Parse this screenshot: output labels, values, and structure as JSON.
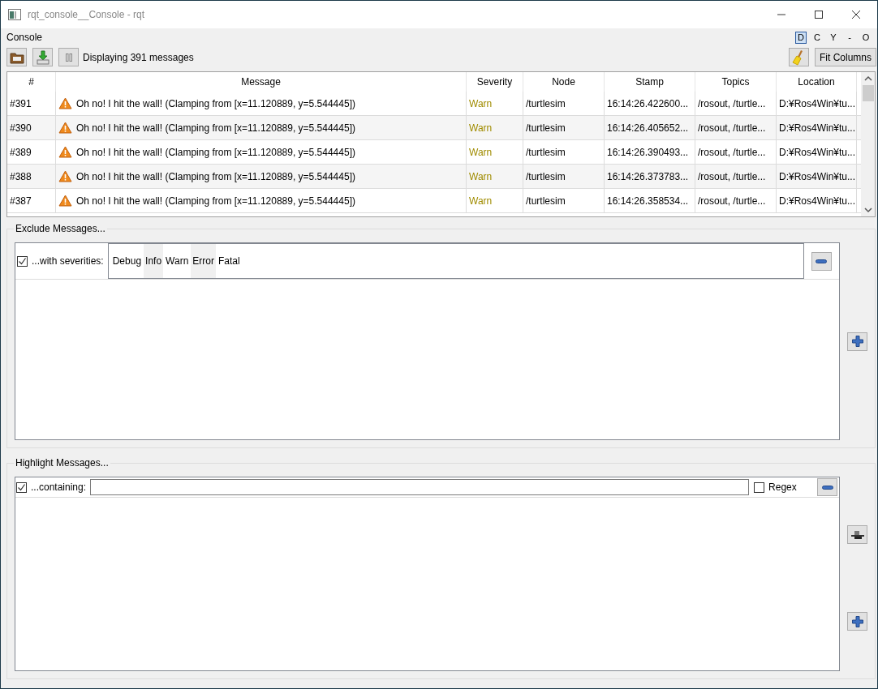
{
  "window": {
    "title": "rqt_console__Console - rqt"
  },
  "dock": {
    "title": "Console",
    "buttons": [
      {
        "label": "D",
        "selected": true
      },
      {
        "label": "C",
        "selected": false
      },
      {
        "label": "Y",
        "selected": false
      },
      {
        "label": "-",
        "selected": false
      },
      {
        "label": "O",
        "selected": false
      }
    ]
  },
  "toolbar": {
    "status": "Displaying 391 messages",
    "fit_button": "Fit Columns"
  },
  "table": {
    "columns": [
      "#",
      "Message",
      "Severity",
      "Node",
      "Stamp",
      "Topics",
      "Location"
    ],
    "rows": [
      {
        "id": "#391",
        "message": "Oh no! I hit the wall! (Clamping from [x=11.120889, y=5.544445])",
        "severity": "Warn",
        "node": "/turtlesim",
        "stamp": "16:14:26.422600...",
        "topics": "/rosout, /turtle...",
        "location": "D:¥Ros4Win¥tu..."
      },
      {
        "id": "#390",
        "message": "Oh no! I hit the wall! (Clamping from [x=11.120889, y=5.544445])",
        "severity": "Warn",
        "node": "/turtlesim",
        "stamp": "16:14:26.405652...",
        "topics": "/rosout, /turtle...",
        "location": "D:¥Ros4Win¥tu..."
      },
      {
        "id": "#389",
        "message": "Oh no! I hit the wall! (Clamping from [x=11.120889, y=5.544445])",
        "severity": "Warn",
        "node": "/turtlesim",
        "stamp": "16:14:26.390493...",
        "topics": "/rosout, /turtle...",
        "location": "D:¥Ros4Win¥tu..."
      },
      {
        "id": "#388",
        "message": "Oh no! I hit the wall! (Clamping from [x=11.120889, y=5.544445])",
        "severity": "Warn",
        "node": "/turtlesim",
        "stamp": "16:14:26.373783...",
        "topics": "/rosout, /turtle...",
        "location": "D:¥Ros4Win¥tu..."
      },
      {
        "id": "#387",
        "message": "Oh no! I hit the wall! (Clamping from [x=11.120889, y=5.544445])",
        "severity": "Warn",
        "node": "/turtlesim",
        "stamp": "16:14:26.358534...",
        "topics": "/rosout, /turtle...",
        "location": "D:¥Ros4Win¥tu..."
      }
    ]
  },
  "exclude": {
    "title": "Exclude Messages...",
    "filter": {
      "checked": true,
      "label": "...with severities:",
      "severities": [
        {
          "label": "Debug",
          "selected": false
        },
        {
          "label": "Info",
          "selected": true
        },
        {
          "label": "Warn",
          "selected": false
        },
        {
          "label": "Error",
          "selected": true
        },
        {
          "label": "Fatal",
          "selected": false
        }
      ]
    }
  },
  "highlight": {
    "title": "Highlight Messages...",
    "filter": {
      "checked": true,
      "label": "...containing:",
      "regex_label": "Regex",
      "regex_checked": false
    }
  }
}
